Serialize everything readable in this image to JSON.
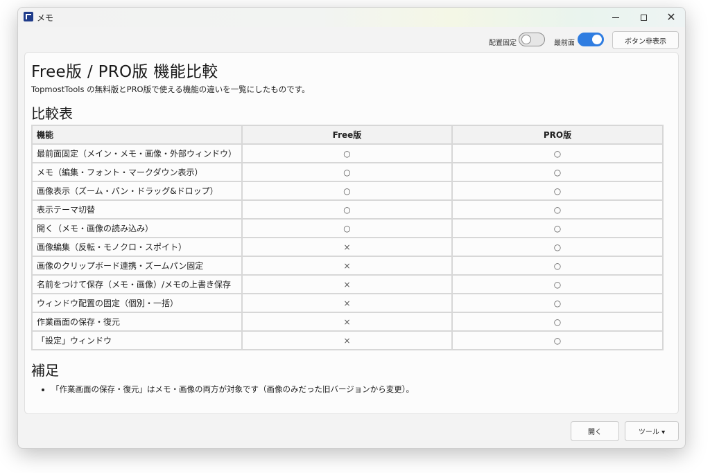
{
  "window": {
    "title": "メモ",
    "icon": "app-logo-icon",
    "controls": {
      "minimize": "minimize-icon",
      "maximize": "maximize-icon",
      "close": "✕"
    }
  },
  "toolbar": {
    "pin_label": "配置固定",
    "pin_on": false,
    "topmost_label": "最前面",
    "topmost_on": true,
    "hide_buttons_label": "ボタン非表示",
    "accent": "#2f7de1"
  },
  "content": {
    "title": "Free版 / PRO版 機能比較",
    "description": "TopmostTools の無料版とPRO版で使える機能の違いを一覧にしたものです。",
    "table_heading": "比較表",
    "table": {
      "headers": [
        "機能",
        "Free版",
        "PRO版"
      ],
      "rows": [
        [
          "最前面固定（メイン・メモ・画像・外部ウィンドウ）",
          "○",
          "○"
        ],
        [
          "メモ（編集・フォント・マークダウン表示）",
          "○",
          "○"
        ],
        [
          "画像表示（ズーム・パン・ドラッグ&ドロップ）",
          "○",
          "○"
        ],
        [
          "表示テーマ切替",
          "○",
          "○"
        ],
        [
          "開く（メモ・画像の読み込み）",
          "○",
          "○"
        ],
        [
          "画像編集（反転・モノクロ・スポイト）",
          "×",
          "○"
        ],
        [
          "画像のクリップボード連携・ズームパン固定",
          "×",
          "○"
        ],
        [
          "名前をつけて保存（メモ・画像）/メモの上書き保存",
          "×",
          "○"
        ],
        [
          "ウィンドウ配置の固定（個別・一括）",
          "×",
          "○"
        ],
        [
          "作業画面の保存・復元",
          "×",
          "○"
        ],
        [
          "「設定」ウィンドウ",
          "×",
          "○"
        ]
      ]
    },
    "notes_heading": "補足",
    "notes": [
      "「作業画面の保存・復元」はメモ・画像の両方が対象です（画像のみだった旧バージョンから変更）。"
    ]
  },
  "footer": {
    "open_label": "開く",
    "tools_label": "ツール ▾"
  }
}
